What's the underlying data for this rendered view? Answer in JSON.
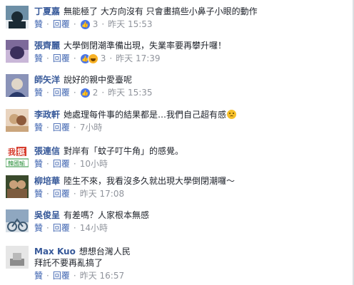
{
  "actions": {
    "like": "贊",
    "reply": "回覆",
    "sep": "·"
  },
  "comments": [
    {
      "author": "丁夏嘉",
      "text": "無能極了 大方向沒有 只會畫搞些小鼻子小眼的動作",
      "reactions": {
        "icons": [
          "like-icon"
        ],
        "count": "3"
      },
      "time": "昨天 15:53",
      "avatar_colors": [
        "#1a2a34",
        "#6d8fa6",
        "#e6ebef"
      ]
    },
    {
      "author": "張齊麗",
      "text": "大學倒閉潮準備出現，失業率要再攀升囉！",
      "reactions": {
        "icons": [
          "like-icon",
          "haha-icon"
        ],
        "count": "3"
      },
      "time": "昨天 17:39",
      "avatar_colors": [
        "#3b2f5c",
        "#7d6a9a",
        "#c9b7d8"
      ]
    },
    {
      "author": "師矢洋",
      "text": "說好的親中愛臺呢",
      "reactions": {
        "icons": [
          "like-icon"
        ],
        "count": "2"
      },
      "time": "昨天 15:35",
      "avatar_colors": [
        "#2a3a6a",
        "#8a93b8",
        "#e0d6c8"
      ]
    },
    {
      "author": "李政軒",
      "text": "她處理每件事的結果都是…我們自己超有感",
      "emoji": "sad-emoji",
      "reactions": null,
      "time": "7小時",
      "avatar_colors": [
        "#caa57c",
        "#e9d4bf",
        "#8d5a3b"
      ]
    },
    {
      "author": "張連信",
      "text": "對岸有「蚊子叮牛角」的感覺。",
      "reactions": null,
      "time": "10小時",
      "avatar_colors": [
        "#ffffff",
        "#d63b2c",
        "#2a8f3a"
      ],
      "avatar_text": [
        "我",
        "挺",
        "韓國瑜"
      ]
    },
    {
      "author": "柳培華",
      "text": "陸生不來，我看沒多久就出現大學倒閉潮囉～",
      "reactions": null,
      "time": "昨天 17:08",
      "avatar_colors": [
        "#7c5b3e",
        "#c9a07a",
        "#3a4a2c"
      ]
    },
    {
      "author": "吳俊呈",
      "text": "有差嗎？人家根本無感",
      "reactions": null,
      "time": "14小時",
      "avatar_colors": [
        "#8fa7c0",
        "#3f5a72",
        "#d8dfe6"
      ]
    },
    {
      "author": "Max Kuo",
      "text": "想想台灣人民",
      "text2": "拜託不要再亂搞了",
      "reactions": null,
      "time": "昨天 16:57",
      "avatar_colors": [
        "#e6e6e6",
        "#b9b9b9",
        "#8c8c8c"
      ]
    }
  ]
}
